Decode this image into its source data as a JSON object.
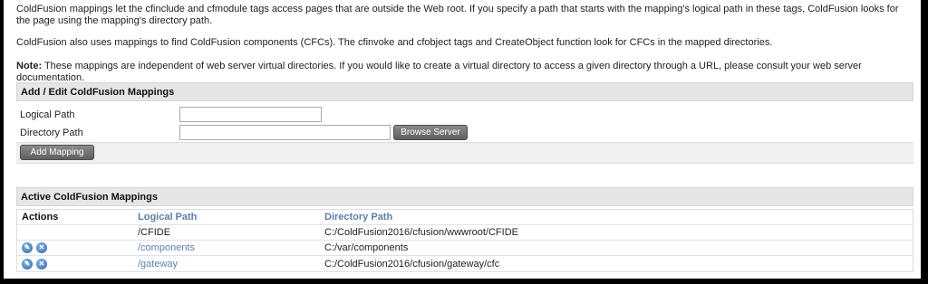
{
  "intro": {
    "p1": "ColdFusion mappings let the cfinclude and cfmodule tags access pages that are outside the Web root. If you specify a path that starts with the mapping's logical path in these tags, ColdFusion looks for the page using the mapping's directory path.",
    "p2": "ColdFusion also uses mappings to find ColdFusion components (CFCs). The cfinvoke and cfobject tags and CreateObject function look for CFCs in the mapped directories.",
    "note_label": "Note:",
    "note_text": " These mappings are independent of web server virtual directories. If you would like to create a virtual directory to access a given directory through a URL, please consult your web server documentation."
  },
  "form": {
    "title": "Add / Edit ColdFusion Mappings",
    "logical_label": "Logical Path",
    "logical_value": "",
    "directory_label": "Directory Path",
    "directory_value": "",
    "browse_label": "Browse Server",
    "add_label": "Add Mapping"
  },
  "mappings": {
    "title": "Active ColdFusion Mappings",
    "headers": {
      "actions": "Actions",
      "logical": "Logical Path",
      "directory": "Directory Path"
    },
    "rows": [
      {
        "logical": "/CFIDE",
        "directory": "C:/ColdFusion2016/cfusion/wwwroot/CFIDE",
        "editable": false
      },
      {
        "logical": "/components",
        "directory": "C:/var/components",
        "editable": true
      },
      {
        "logical": "/gateway",
        "directory": "C:/ColdFusion2016/cfusion/gateway/cfc",
        "editable": true
      }
    ]
  },
  "icons": {
    "edit": "pencil-icon",
    "delete": "delete-icon"
  }
}
